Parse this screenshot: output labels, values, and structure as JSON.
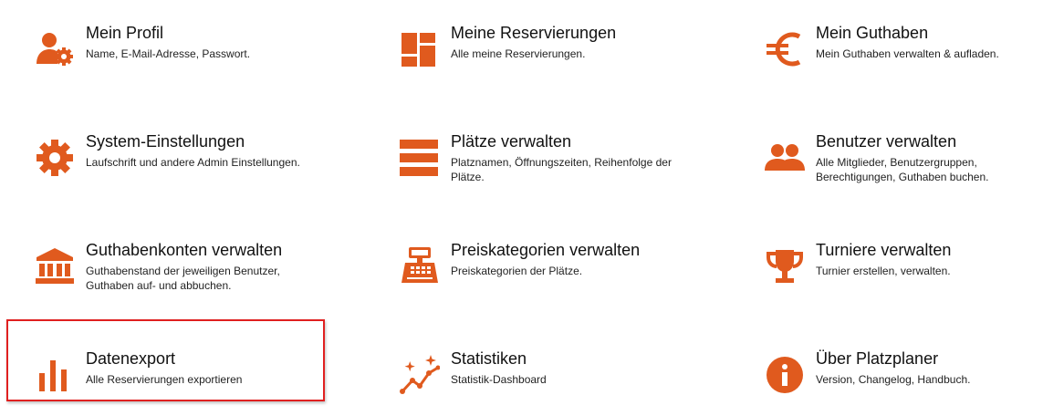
{
  "accent_color": "#e05a1e",
  "highlight_color": "#e02020",
  "tiles": [
    {
      "title": "Mein Profil",
      "desc": "Name, E-Mail-Adresse, Passwort.",
      "icon": "user-gear-icon"
    },
    {
      "title": "Meine Reservierungen",
      "desc": "Alle meine Reservierungen.",
      "icon": "dashboard-icon"
    },
    {
      "title": "Mein Guthaben",
      "desc": "Mein Guthaben verwalten & aufladen.",
      "icon": "euro-icon"
    },
    {
      "title": "System-Einstellungen",
      "desc": "Laufschrift und andere Admin Einstellungen.",
      "icon": "gear-icon"
    },
    {
      "title": "Plätze verwalten",
      "desc": "Platznamen, Öffnungszeiten, Reihenfolge der Plätze.",
      "icon": "list-bars-icon"
    },
    {
      "title": "Benutzer verwalten",
      "desc": "Alle Mitglieder, Benutzergruppen, Berechtigungen, Guthaben buchen.",
      "icon": "users-icon"
    },
    {
      "title": "Guthabenkonten verwalten",
      "desc": "Guthabenstand der jeweiligen Benutzer, Guthaben auf- und abbuchen.",
      "icon": "bank-icon"
    },
    {
      "title": "Preiskategorien verwalten",
      "desc": "Preiskategorien der Plätze.",
      "icon": "cash-register-icon"
    },
    {
      "title": "Turniere verwalten",
      "desc": "Turnier erstellen, verwalten.",
      "icon": "trophy-icon"
    },
    {
      "title": "Datenexport",
      "desc": "Alle Reservierungen exportieren",
      "icon": "bar-chart-icon"
    },
    {
      "title": "Statistiken",
      "desc": "Statistik-Dashboard",
      "icon": "sparkle-line-chart-icon"
    },
    {
      "title": "Über Platzplaner",
      "desc": "Version, Changelog, Handbuch.",
      "icon": "info-icon"
    }
  ]
}
